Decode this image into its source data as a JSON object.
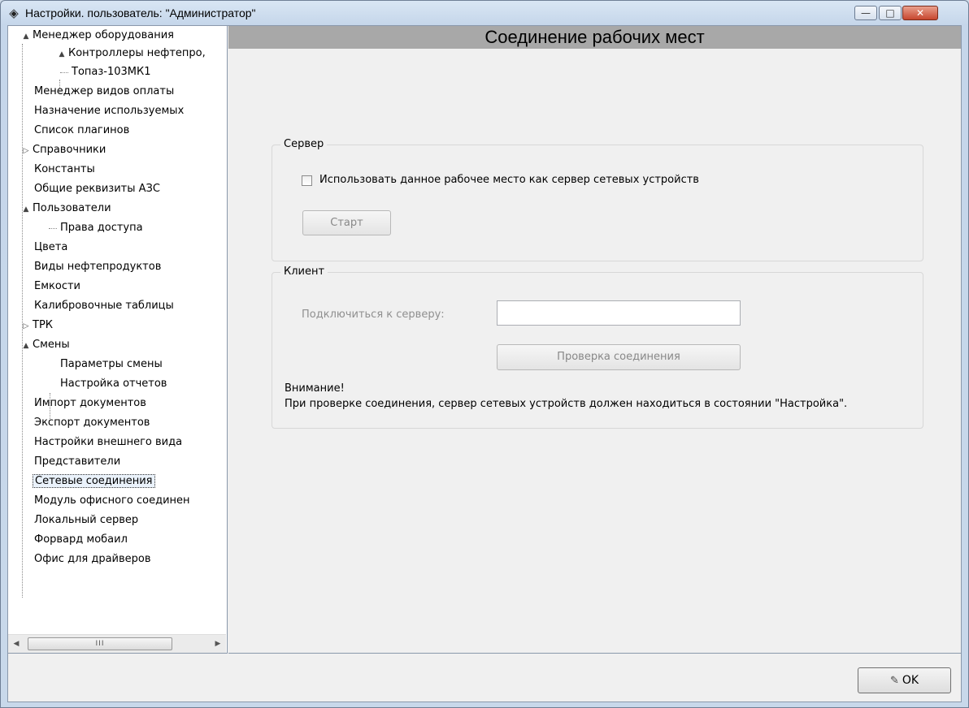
{
  "window": {
    "title": "Настройки. пользователь: \"Администратор\"",
    "icon": "settings-diamond-icon",
    "min_glyph": "—",
    "max_glyph": "□",
    "close_glyph": "✕"
  },
  "tree": {
    "items": [
      {
        "label": "Менеджер оборудования",
        "expander": "▲"
      },
      {
        "label": "Контроллеры нефтепро,",
        "expander": "▲"
      },
      {
        "label": "Топаз-103МК1",
        "expander": ""
      },
      {
        "label": "Менеджер видов оплаты",
        "expander": ""
      },
      {
        "label": "Назначение используемых",
        "expander": ""
      },
      {
        "label": "Список плагинов",
        "expander": ""
      },
      {
        "label": "Справочники",
        "expander": "▷"
      },
      {
        "label": "Константы",
        "expander": ""
      },
      {
        "label": "Общие реквизиты АЗС",
        "expander": ""
      },
      {
        "label": "Пользователи",
        "expander": "▲"
      },
      {
        "label": "Права доступа",
        "expander": ""
      },
      {
        "label": "Цвета",
        "expander": ""
      },
      {
        "label": "Виды нефтепродуктов",
        "expander": ""
      },
      {
        "label": "Емкости",
        "expander": ""
      },
      {
        "label": "Калибровочные таблицы",
        "expander": ""
      },
      {
        "label": "ТРК",
        "expander": "▷"
      },
      {
        "label": "Смены",
        "expander": "▲"
      },
      {
        "label": "Параметры смены",
        "expander": ""
      },
      {
        "label": "Настройка отчетов",
        "expander": ""
      },
      {
        "label": "Импорт документов",
        "expander": ""
      },
      {
        "label": "Экспорт документов",
        "expander": ""
      },
      {
        "label": "Настройки внешнего вида",
        "expander": ""
      },
      {
        "label": "Представители",
        "expander": ""
      },
      {
        "label": "Сетевые соединения",
        "expander": ""
      },
      {
        "label": "Модуль офисного соединен",
        "expander": ""
      },
      {
        "label": "Локальный сервер",
        "expander": ""
      },
      {
        "label": "Форвард мобаил",
        "expander": ""
      },
      {
        "label": "Офис для драйверов",
        "expander": ""
      }
    ],
    "selected": "Сетевые соединения",
    "scroll_left": "◀",
    "scroll_right": "▶",
    "scroll_grip": "III"
  },
  "main": {
    "header": "Соединение рабочих мест",
    "server": {
      "legend": "Сервер",
      "checkbox_label": "Использовать данное рабочее место как сервер сетевых устройств",
      "checked": false,
      "start_button": "Старт"
    },
    "client": {
      "legend": "Клиент",
      "connect_label": "Подключиться к серверу:",
      "connect_value": "",
      "check_button": "Проверка соединения",
      "warning_title": "Внимание!",
      "warning_text": "При проверке соединения, сервер сетевых устройств должен находиться в состоянии \"Настройка\"."
    }
  },
  "footer": {
    "ok_label": "OK",
    "ok_icon": "ok-pencil-icon"
  }
}
